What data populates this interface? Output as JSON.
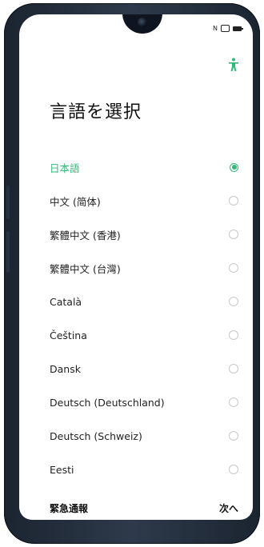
{
  "status_bar": {
    "icons": [
      "nfc-icon",
      "vibrate-icon",
      "battery-charging-icon"
    ],
    "nfc_text": "N",
    "vibrate_text": "◘"
  },
  "header": {
    "title": "言語を選択"
  },
  "languages": [
    {
      "label": "日本語",
      "selected": true
    },
    {
      "label": "中文 (简体)",
      "selected": false
    },
    {
      "label": "繁體中文 (香港)",
      "selected": false
    },
    {
      "label": "繁體中文 (台灣)",
      "selected": false
    },
    {
      "label": "Català",
      "selected": false
    },
    {
      "label": "Čeština",
      "selected": false
    },
    {
      "label": "Dansk",
      "selected": false
    },
    {
      "label": "Deutsch (Deutschland)",
      "selected": false
    },
    {
      "label": "Deutsch (Schweiz)",
      "selected": false
    },
    {
      "label": "Eesti",
      "selected": false
    }
  ],
  "footer": {
    "emergency_label": "緊急通報",
    "next_label": "次へ"
  },
  "colors": {
    "accent": "#2fb978",
    "text": "#222222",
    "frame": "#1b2430"
  }
}
